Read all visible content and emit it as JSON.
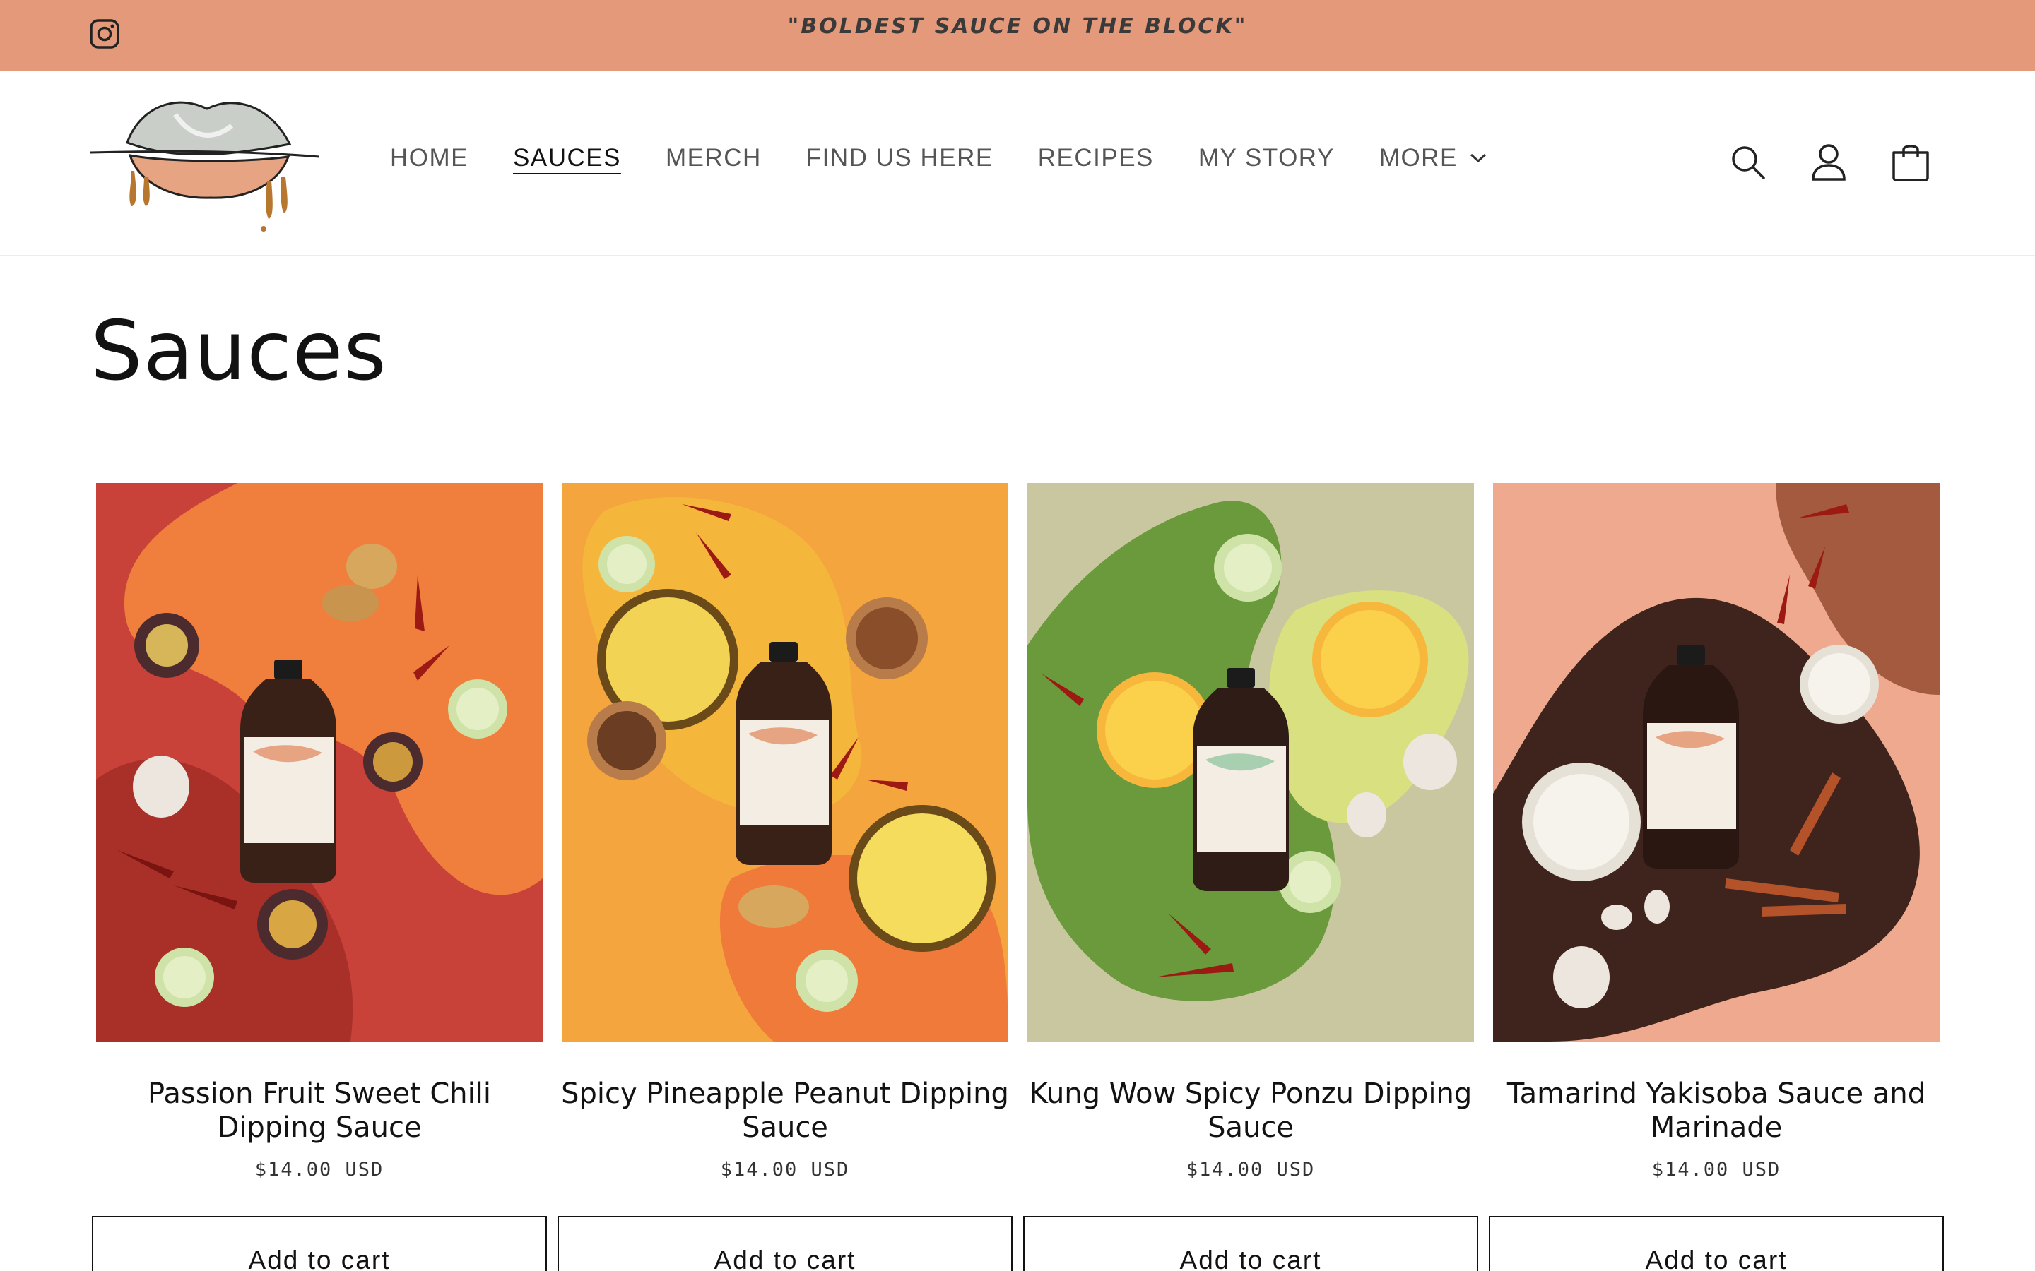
{
  "announcement": {
    "text": "\"BOLDEST SAUCE ON THE BLOCK\""
  },
  "colors": {
    "announcement_bg": "#e49a7a",
    "text": "#121212",
    "nav_text": "#555555"
  },
  "header": {
    "nav": [
      {
        "label": "HOME"
      },
      {
        "label": "SAUCES"
      },
      {
        "label": "MERCH"
      },
      {
        "label": "FIND US HERE"
      },
      {
        "label": "RECIPES"
      },
      {
        "label": "MY STORY"
      },
      {
        "label": "MORE"
      }
    ],
    "active_nav": "SAUCES",
    "icons": [
      "search-icon",
      "account-icon",
      "cart-icon"
    ]
  },
  "page": {
    "title": "Sauces"
  },
  "products": [
    {
      "title": "Passion Fruit Sweet Chili Dipping Sauce",
      "price": "$14.00 USD",
      "button": "Add to cart"
    },
    {
      "title": "Spicy Pineapple Peanut Dipping Sauce",
      "price": "$14.00 USD",
      "button": "Add to cart"
    },
    {
      "title": "Kung Wow Spicy Ponzu Dipping Sauce",
      "price": "$14.00 USD",
      "button": "Add to cart"
    },
    {
      "title": "Tamarind Yakisoba Sauce and Marinade",
      "price": "$14.00 USD",
      "button": "Add to cart"
    }
  ]
}
